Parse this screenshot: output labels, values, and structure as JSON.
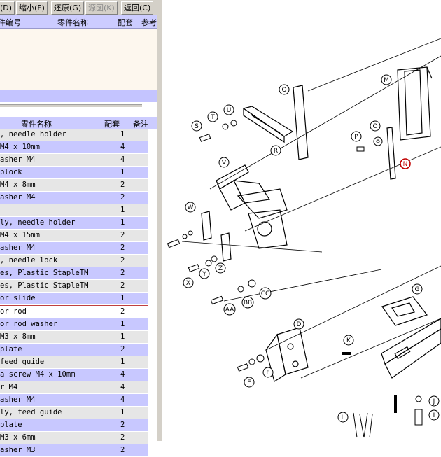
{
  "toolbar": {
    "btn_d": "(D)",
    "btn_shrink": "缩小(F)",
    "btn_restore": "还原(G)",
    "btn_source": "源图(K)",
    "btn_back": "返回(C)"
  },
  "top_grid": {
    "headers": [
      "件编号",
      "零件名称",
      "配套",
      "参考"
    ]
  },
  "bottom_grid": {
    "headers": [
      "零件名称",
      "配套",
      "备注"
    ],
    "rows": [
      {
        "name": ", needle holder",
        "qty": "1"
      },
      {
        "name": "M4 x 10mm",
        "qty": "4"
      },
      {
        "name": "asher M4",
        "qty": "4"
      },
      {
        "name": " block",
        "qty": "1"
      },
      {
        "name": "M4 x 8mm",
        "qty": "2"
      },
      {
        "name": "asher M4",
        "qty": "2"
      },
      {
        "name": "",
        "qty": "1"
      },
      {
        "name": "ly, needle holder",
        "qty": "1"
      },
      {
        "name": "M4 x 15mm",
        "qty": "2"
      },
      {
        "name": "asher M4",
        "qty": "2"
      },
      {
        "name": ", needle lock",
        "qty": "2"
      },
      {
        "name": "es, Plastic StapleTM",
        "qty": "2"
      },
      {
        "name": "es, Plastic StapleTM",
        "qty": "2"
      },
      {
        "name": "or slide",
        "qty": "1"
      },
      {
        "name": "or rod",
        "qty": "2"
      },
      {
        "name": "or rod washer",
        "qty": "1"
      },
      {
        "name": "M3 x 8mm",
        "qty": "1"
      },
      {
        "name": " plate",
        "qty": "2"
      },
      {
        "name": " feed guide",
        "qty": "1"
      },
      {
        "name": "a screw M4 x 10mm",
        "qty": "4"
      },
      {
        "name": "r M4",
        "qty": "4"
      },
      {
        "name": "asher M4",
        "qty": "4"
      },
      {
        "name": "ly, feed guide",
        "qty": "1"
      },
      {
        "name": " plate",
        "qty": "2"
      },
      {
        "name": "M3 x 6mm",
        "qty": "2"
      },
      {
        "name": "asher M3",
        "qty": "2"
      }
    ],
    "selected_index": 14
  },
  "diagram": {
    "callouts": [
      "M",
      "Q",
      "T",
      "U",
      "S",
      "R",
      "P",
      "O",
      "N",
      "V",
      "W",
      "X",
      "Y",
      "Z",
      "AA",
      "BB",
      "CC",
      "G",
      "D",
      "K",
      "E",
      "F",
      "L",
      "J",
      "I"
    ]
  },
  "colors": {
    "header_bg": "#ccccff",
    "row_alt_bg": "#c8c8ff",
    "row_bg": "#e6e6e6",
    "selected_callout": "#c00000",
    "toolbar_bg": "#d4d0c8"
  }
}
